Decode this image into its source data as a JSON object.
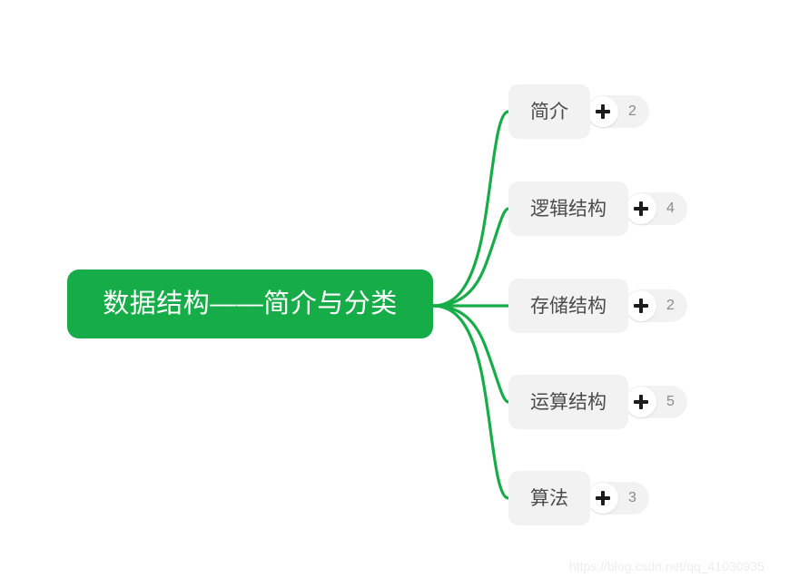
{
  "mindmap": {
    "root": {
      "label": "数据结构——简介与分类",
      "color": "#16ad49",
      "text_color": "#ffffff"
    },
    "branch_color": "#16ad49",
    "node_bg": "#f2f2f2",
    "node_text_color": "#4b4b4b",
    "children": [
      {
        "label": "简介",
        "expand_icon": "plus-icon",
        "count": "2"
      },
      {
        "label": "逻辑结构",
        "expand_icon": "plus-icon",
        "count": "4"
      },
      {
        "label": "存储结构",
        "expand_icon": "plus-icon",
        "count": "2"
      },
      {
        "label": "运算结构",
        "expand_icon": "plus-icon",
        "count": "5"
      },
      {
        "label": "算法",
        "expand_icon": "plus-icon",
        "count": "3"
      }
    ]
  },
  "watermark": {
    "text": "https://blog.csdn.net/qq_41030935"
  }
}
